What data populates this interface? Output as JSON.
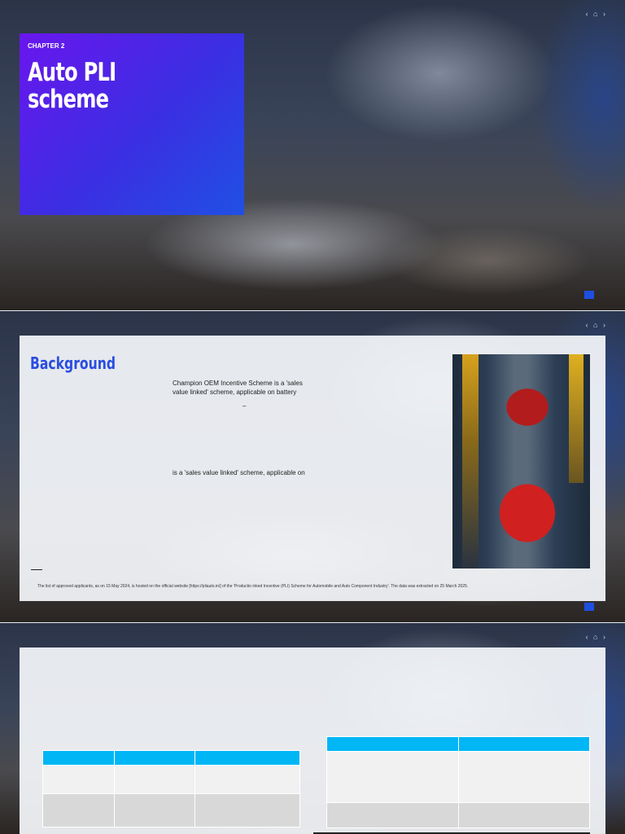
{
  "slide1": {
    "chapter": "CHAPTER 2",
    "title": "Auto PLI scheme",
    "nav": "‹ ⌂ ›"
  },
  "slide2": {
    "heading": "Background",
    "para1": "Champion OEM Incentive Scheme is a 'sales value linked' scheme, applicable on battery",
    "dash": "–",
    "para2": "is a 'sales value linked' scheme, applicable on",
    "footnote": "The list of approved applicants, as on 15 May 2024, is hosted on the official website [https://pliauto.in/] of the 'Productio     inked Incentive (PLI) Scheme for Automobile and Auto Component Industry'. The data was extracted on 25 March 2025.",
    "nav": "‹ ⌂ ›"
  },
  "slide3": {
    "nav": "‹ ⌂ ›"
  },
  "colors": {
    "accent": "#1f4fe0",
    "table_header": "#00b6f5",
    "heading": "#2a4de0"
  }
}
